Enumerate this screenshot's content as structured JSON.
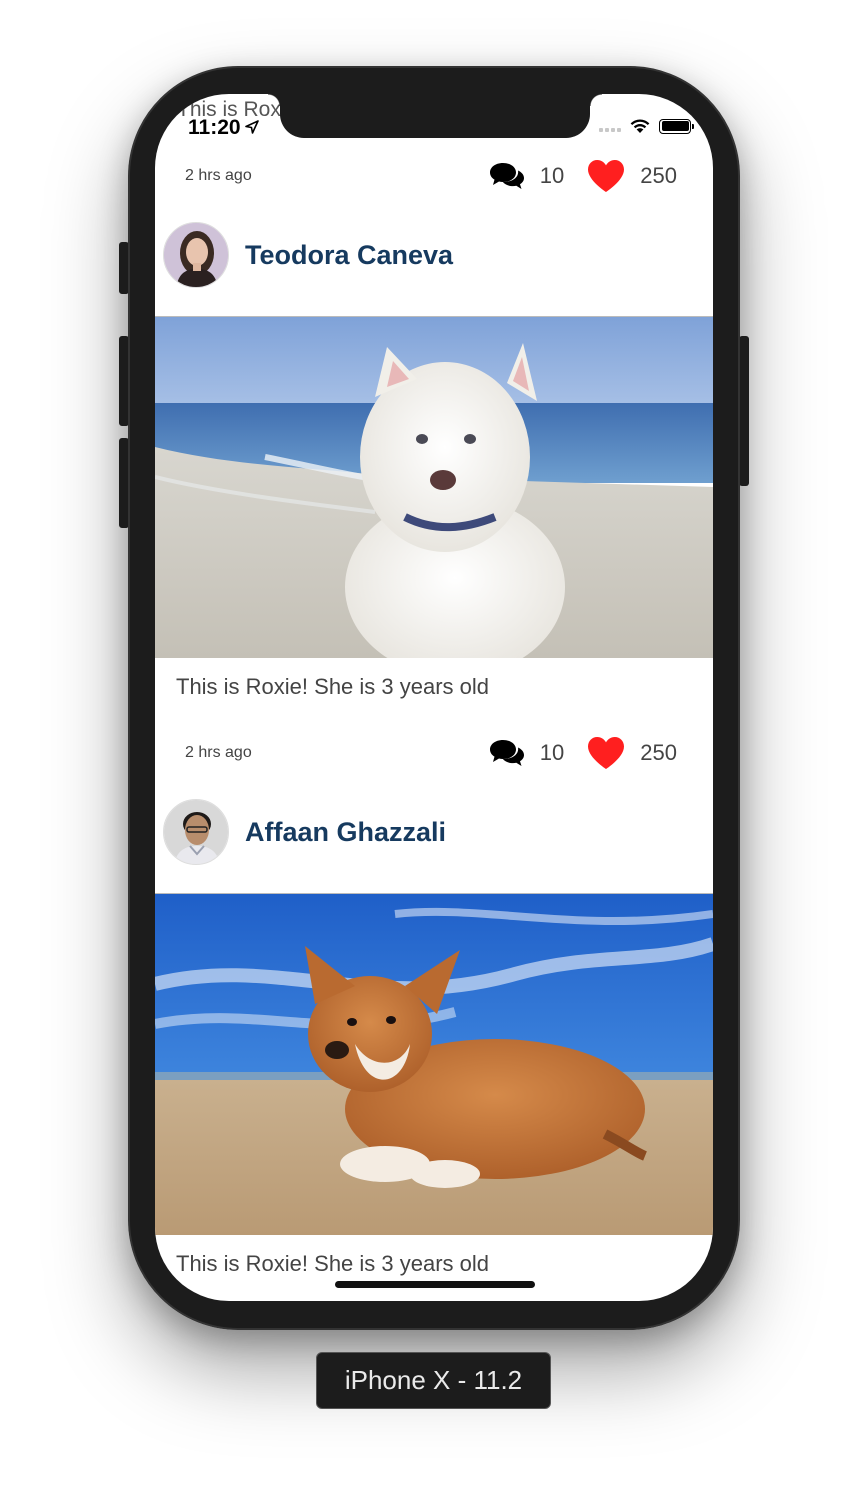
{
  "status_bar": {
    "overlap_text": "This is Rox",
    "time": "11:20"
  },
  "feed": {
    "top_meta": {
      "time_ago": "2 hrs ago",
      "comments": "10",
      "likes": "250"
    },
    "posts": [
      {
        "author": "Teodora Caneva",
        "caption": "This is Roxie! She is 3 years old",
        "time_ago": "2 hrs ago",
        "comments": "10",
        "likes": "250"
      },
      {
        "author": "Affaan Ghazzali",
        "caption": "This is Roxie! She is 3 years old"
      }
    ]
  },
  "device_label": "iPhone X - 11.2",
  "colors": {
    "author_name": "#163a5f",
    "heart": "#ff1f1f",
    "frame": "#1c1c1c"
  },
  "icons": {
    "comment": "comments-icon",
    "like": "heart-icon",
    "location": "location-arrow-icon",
    "wifi": "wifi-icon",
    "battery": "battery-icon"
  }
}
